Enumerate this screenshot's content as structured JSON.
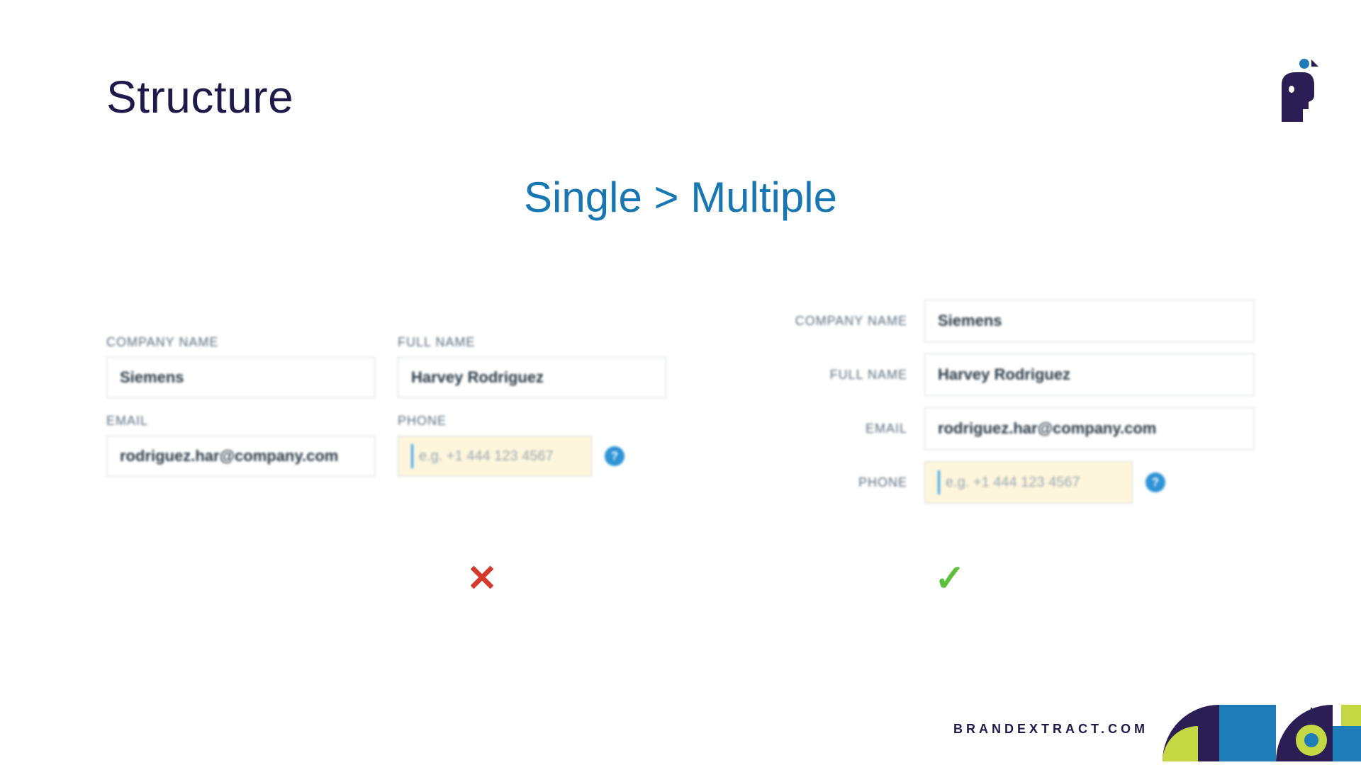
{
  "page_title": "Structure",
  "subtitle": "Single > Multiple",
  "left_form": {
    "company_label": "COMPANY NAME",
    "company_value": "Siemens",
    "fullname_label": "FULL NAME",
    "fullname_value": "Harvey Rodriguez",
    "email_label": "EMAIL",
    "email_value": "rodriguez.har@company.com",
    "phone_label": "PHONE",
    "phone_placeholder": "e.g. +1 444 123 4567",
    "help_symbol": "?"
  },
  "right_form": {
    "company_label": "COMPANY NAME",
    "company_value": "Siemens",
    "fullname_label": "FULL NAME",
    "fullname_value": "Harvey Rodriguez",
    "email_label": "EMAIL",
    "email_value": "rodriguez.har@company.com",
    "phone_label": "PHONE",
    "phone_placeholder": "e.g. +1 444 123 4567",
    "help_symbol": "?"
  },
  "marks": {
    "cross": "✕",
    "check": "✓"
  },
  "footer": {
    "url": "BRANDEXTRACT.COM"
  }
}
